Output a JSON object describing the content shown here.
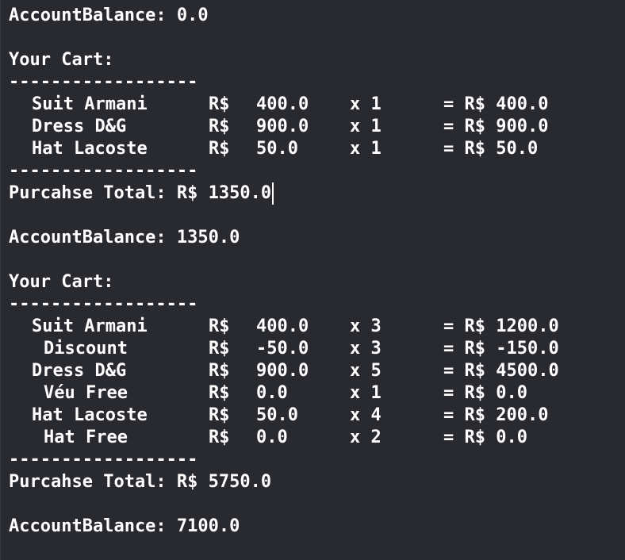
{
  "separator": "------------------",
  "blocks": [
    {
      "balance_before": "AccountBalance: 0.0",
      "cart_title": "Your Cart:",
      "items": [
        {
          "name": "Suit Armani",
          "indent": false,
          "currency": "R$",
          "price": "400.0",
          "qty": "x 1",
          "total": "= R$ 400.0"
        },
        {
          "name": "Dress D&G",
          "indent": false,
          "currency": "R$",
          "price": "900.0",
          "qty": "x 1",
          "total": "= R$ 900.0"
        },
        {
          "name": "Hat Lacoste",
          "indent": false,
          "currency": "R$",
          "price": "50.0",
          "qty": "x 1",
          "total": "= R$ 50.0"
        }
      ],
      "purchase_total": "Purcahse Total: R$ 1350.0"
    },
    {
      "balance_before": "AccountBalance: 1350.0",
      "cart_title": "Your Cart:",
      "items": [
        {
          "name": "Suit Armani",
          "indent": false,
          "currency": "R$",
          "price": "400.0",
          "qty": "x 3",
          "total": "= R$ 1200.0"
        },
        {
          "name": "Discount",
          "indent": true,
          "currency": "R$",
          "price": "-50.0",
          "qty": "x 3",
          "total": "= R$ -150.0"
        },
        {
          "name": "Dress D&G",
          "indent": false,
          "currency": "R$",
          "price": "900.0",
          "qty": "x 5",
          "total": "= R$ 4500.0"
        },
        {
          "name": "Véu Free",
          "indent": true,
          "currency": "R$",
          "price": "0.0",
          "qty": "x 1",
          "total": "= R$ 0.0"
        },
        {
          "name": "Hat Lacoste",
          "indent": false,
          "currency": "R$",
          "price": "50.0",
          "qty": "x 4",
          "total": "= R$ 200.0"
        },
        {
          "name": "Hat Free",
          "indent": true,
          "currency": "R$",
          "price": "0.0",
          "qty": "x 2",
          "total": "= R$ 0.0"
        }
      ],
      "purchase_total": "Purcahse Total: R$ 5750.0"
    }
  ],
  "final_balance": "AccountBalance: 7100.0"
}
